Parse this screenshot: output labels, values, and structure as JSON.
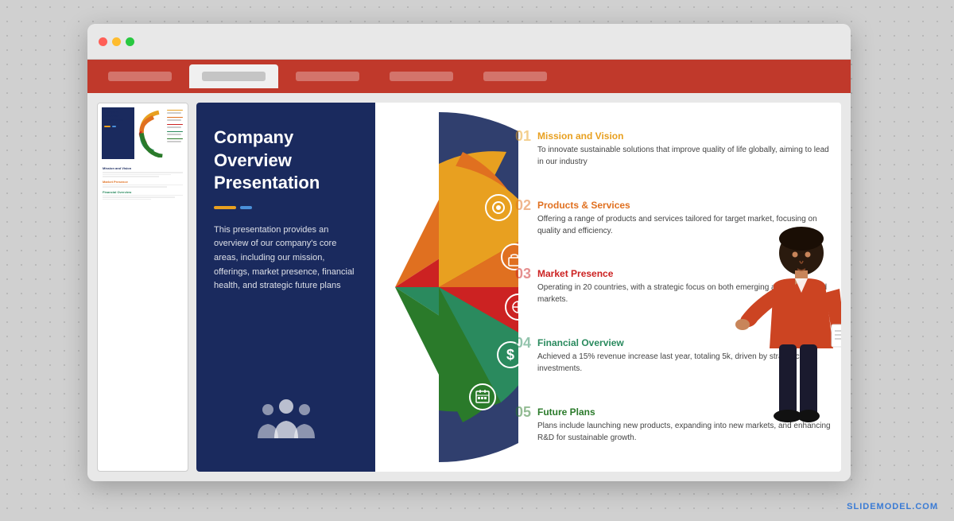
{
  "browser": {
    "dots": [
      "red",
      "yellow",
      "green"
    ],
    "tabs": [
      {
        "label": "",
        "active": false
      },
      {
        "label": "",
        "active": true
      },
      {
        "label": "",
        "active": false
      },
      {
        "label": "",
        "active": false
      },
      {
        "label": "",
        "active": false
      }
    ]
  },
  "thumbnail": {
    "title": "Company Overview\nPresentation"
  },
  "slide": {
    "title": "Company Overview\nPresentation",
    "divider": true,
    "description": "This presentation provides an overview of our company's core areas, including our mission, offerings, market presence, financial health, and strategic future plans"
  },
  "items": [
    {
      "num": "01",
      "title": "Mission and Vision",
      "title_color": "#e8a020",
      "text": "To innovate sustainable solutions that improve quality of life globally, aiming to lead in our industry",
      "color": "#e8a020",
      "icon": "👁"
    },
    {
      "num": "02",
      "title": "Products & Services",
      "title_color": "#e07020",
      "text": "Offering a range of products and services tailored for target market, focusing on quality and efficiency.",
      "color": "#e07020",
      "icon": "💼"
    },
    {
      "num": "03",
      "title": "Market Presence",
      "title_color": "#cc2222",
      "text": "Operating in 20 countries, with a strategic focus on both emerging and established markets.",
      "color": "#cc2222",
      "icon": "🎯"
    },
    {
      "num": "04",
      "title": "Financial Overview",
      "title_color": "#2a8a5e",
      "text": "Achieved a 15% revenue increase last year, totaling 5k, driven by strategic investments.",
      "color": "#2a8a5e",
      "icon": "$"
    },
    {
      "num": "05",
      "title": "Future Plans",
      "title_color": "#2a7a2a",
      "text": "Plans include launching new products, expanding into new markets, and enhancing R&D for sustainable growth.",
      "color": "#2a7a2a",
      "icon": "📅"
    }
  ],
  "watermark": "SLIDEMODEL.COM",
  "wheel_colors": [
    "#e8a020",
    "#e07020",
    "#cc2222",
    "#2a8a5e",
    "#2a7a2a"
  ]
}
